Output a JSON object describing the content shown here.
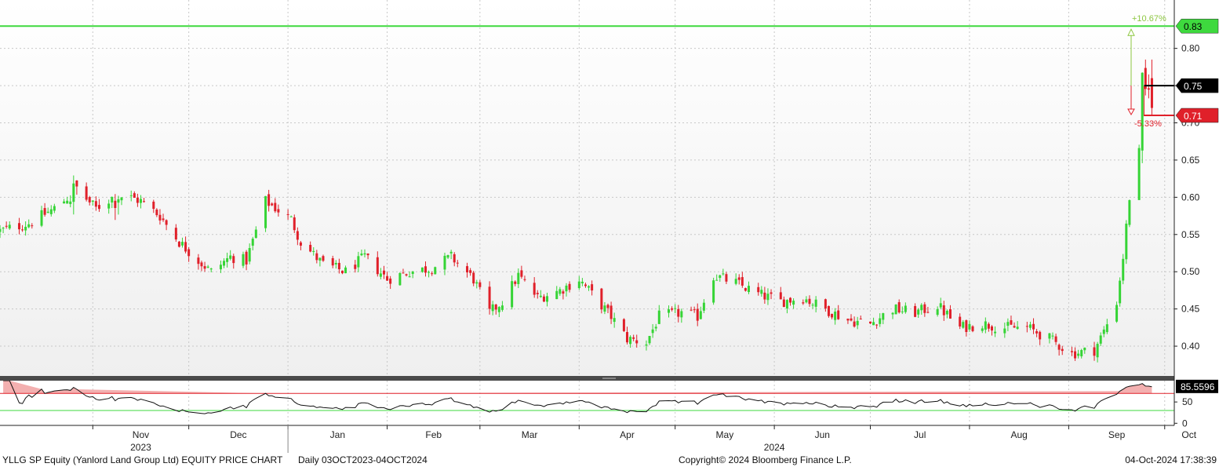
{
  "chart_data": {
    "type": "candlestick",
    "title": "YLLG SP Equity (Yanlord Land Group Ltd) EQUITY PRICE CHART",
    "period_label": "Daily 03OCT2023-04OCT2024",
    "copyright": "Copyright© 2024 Bloomberg Finance L.P.",
    "timestamp": "04-Oct-2024 17:38:39",
    "date_range": [
      "2023-10-03",
      "2024-10-04"
    ],
    "price_axis": {
      "ylim": [
        0.36,
        0.865
      ],
      "ticks": [
        "0.40",
        "0.45",
        "0.50",
        "0.55",
        "0.60",
        "0.65",
        "0.70",
        "0.75",
        "0.80"
      ]
    },
    "month_labels": [
      {
        "label": "Nov",
        "date": "2023-11-01"
      },
      {
        "label": "Dec",
        "date": "2023-12-01"
      },
      {
        "label": "Jan",
        "date": "2024-01-01"
      },
      {
        "label": "Feb",
        "date": "2024-02-01"
      },
      {
        "label": "Mar",
        "date": "2024-03-01"
      },
      {
        "label": "Apr",
        "date": "2024-04-01"
      },
      {
        "label": "May",
        "date": "2024-05-01"
      },
      {
        "label": "Jun",
        "date": "2024-06-01"
      },
      {
        "label": "Jul",
        "date": "2024-07-01"
      },
      {
        "label": "Aug",
        "date": "2024-08-01"
      },
      {
        "label": "Sep",
        "date": "2024-09-01"
      },
      {
        "label": "Oct",
        "date": "2024-10-01"
      }
    ],
    "year_labels": [
      {
        "label": "2023",
        "date": "2023-11-16"
      },
      {
        "label": "2024",
        "date": "2024-06-01"
      }
    ],
    "year_boundary": "2024-01-01",
    "price_path": [
      [
        "2023-10-03",
        0.555
      ],
      [
        "2023-10-12",
        0.565
      ],
      [
        "2023-10-20",
        0.585
      ],
      [
        "2023-10-27",
        0.61
      ],
      [
        "2023-11-02",
        0.585
      ],
      [
        "2023-11-09",
        0.605
      ],
      [
        "2023-11-16",
        0.595
      ],
      [
        "2023-11-22",
        0.575
      ],
      [
        "2023-11-28",
        0.54
      ],
      [
        "2023-12-04",
        0.515
      ],
      [
        "2023-12-08",
        0.5
      ],
      [
        "2023-12-14",
        0.52
      ],
      [
        "2023-12-19",
        0.515
      ],
      [
        "2023-12-25",
        0.595
      ],
      [
        "2024-01-02",
        0.57
      ],
      [
        "2024-01-05",
        0.54
      ],
      [
        "2024-01-12",
        0.51
      ],
      [
        "2024-01-19",
        0.5
      ],
      [
        "2024-01-25",
        0.52
      ],
      [
        "2024-02-01",
        0.49
      ],
      [
        "2024-02-08",
        0.5
      ],
      [
        "2024-02-15",
        0.505
      ],
      [
        "2024-02-21",
        0.52
      ],
      [
        "2024-02-28",
        0.49
      ],
      [
        "2024-03-04",
        0.445
      ],
      [
        "2024-03-08",
        0.46
      ],
      [
        "2024-03-13",
        0.495
      ],
      [
        "2024-03-19",
        0.465
      ],
      [
        "2024-03-26",
        0.475
      ],
      [
        "2024-04-01",
        0.49
      ],
      [
        "2024-04-05",
        0.47
      ],
      [
        "2024-04-11",
        0.44
      ],
      [
        "2024-04-16",
        0.41
      ],
      [
        "2024-04-22",
        0.405
      ],
      [
        "2024-04-26",
        0.44
      ],
      [
        "2024-05-03",
        0.445
      ],
      [
        "2024-05-08",
        0.44
      ],
      [
        "2024-05-13",
        0.495
      ],
      [
        "2024-05-20",
        0.485
      ],
      [
        "2024-05-27",
        0.47
      ],
      [
        "2024-06-03",
        0.46
      ],
      [
        "2024-06-10",
        0.465
      ],
      [
        "2024-06-17",
        0.45
      ],
      [
        "2024-06-24",
        0.435
      ],
      [
        "2024-07-01",
        0.43
      ],
      [
        "2024-07-08",
        0.45
      ],
      [
        "2024-07-15",
        0.445
      ],
      [
        "2024-07-22",
        0.455
      ],
      [
        "2024-07-29",
        0.425
      ],
      [
        "2024-08-05",
        0.43
      ],
      [
        "2024-08-12",
        0.425
      ],
      [
        "2024-08-19",
        0.425
      ],
      [
        "2024-08-26",
        0.41
      ],
      [
        "2024-09-02",
        0.39
      ],
      [
        "2024-09-09",
        0.395
      ],
      [
        "2024-09-12",
        0.42
      ],
      [
        "2024-09-16",
        0.46
      ],
      [
        "2024-09-18",
        0.52
      ],
      [
        "2024-09-20",
        0.6
      ],
      [
        "2024-09-23",
        0.65
      ],
      [
        "2024-09-24",
        0.75
      ],
      [
        "2024-09-25",
        0.74
      ],
      [
        "2024-09-26",
        0.76
      ],
      [
        "2024-09-27",
        0.72
      ]
    ],
    "bars_end_date": "2024-09-27",
    "last_price": {
      "value": 0.75,
      "label": "0.75",
      "color": "#000000"
    },
    "target_high": {
      "value": 0.83,
      "label": "0.83",
      "pct_label": "+10.67%",
      "color": "#3ed93e"
    },
    "target_low": {
      "value": 0.71,
      "label": "0.71",
      "pct_label": "-5.33%",
      "color": "#e0202a"
    },
    "rsi": {
      "value_label": "85.5596",
      "ylim": [
        -5,
        100
      ],
      "ticks": [
        "50",
        "0"
      ],
      "overbought": 70,
      "oversold": 30,
      "overbought_color": "#e0202a",
      "oversold_color": "#3ed93e"
    },
    "colors": {
      "up": "#35d435",
      "down": "#e0202a",
      "grid": "#c8c8c8",
      "panel_sep": "#4a4a4a"
    }
  }
}
